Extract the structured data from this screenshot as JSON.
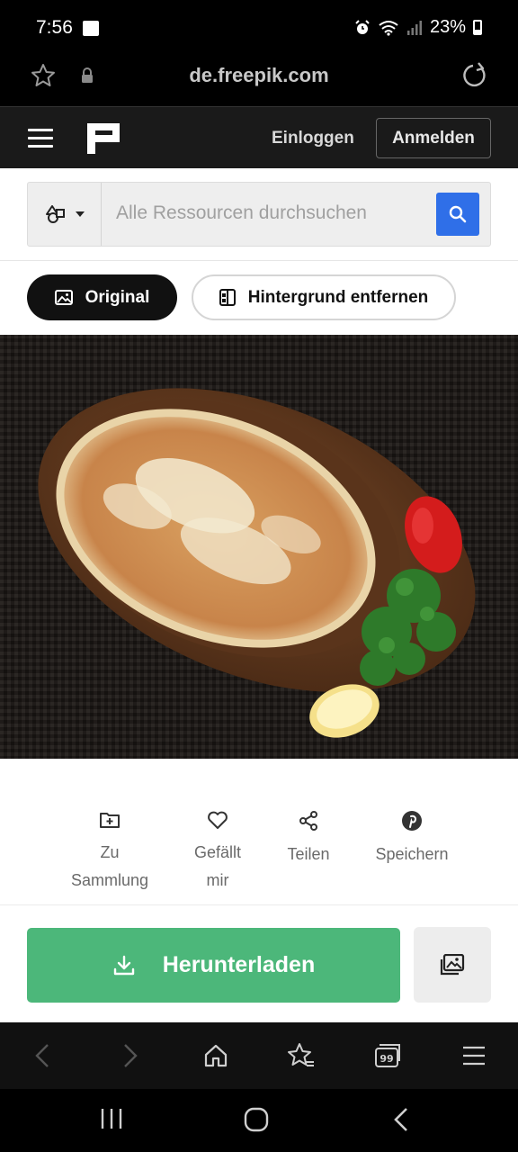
{
  "status_bar": {
    "time": "7:56",
    "battery": "23%",
    "icons": [
      "image-notification-icon",
      "alarm-icon",
      "wifi-icon",
      "signal-icon",
      "battery-icon"
    ]
  },
  "url_bar": {
    "url": "de.freepik.com",
    "icons": [
      "star-icon",
      "lock-icon",
      "reload-icon"
    ]
  },
  "header": {
    "login_label": "Einloggen",
    "signup_label": "Anmelden"
  },
  "search": {
    "placeholder": "Alle Ressourcen durchsuchen"
  },
  "view_toggle": {
    "original_label": "Original",
    "remove_bg_label": "Hintergrund entfernen",
    "active": "Original"
  },
  "actions": [
    {
      "label": "Zu Sammlung",
      "icon": "folder-plus-icon"
    },
    {
      "label": "Gefällt mir",
      "icon": "heart-icon"
    },
    {
      "label": "Teilen",
      "icon": "share-icon"
    },
    {
      "label": "Speichern",
      "icon": "pinterest-icon"
    }
  ],
  "download": {
    "label": "Herunterladen"
  },
  "colors": {
    "accent_blue": "#2f6fe8",
    "download_green": "#4cb77a",
    "header_dark": "#1a1a1a"
  }
}
